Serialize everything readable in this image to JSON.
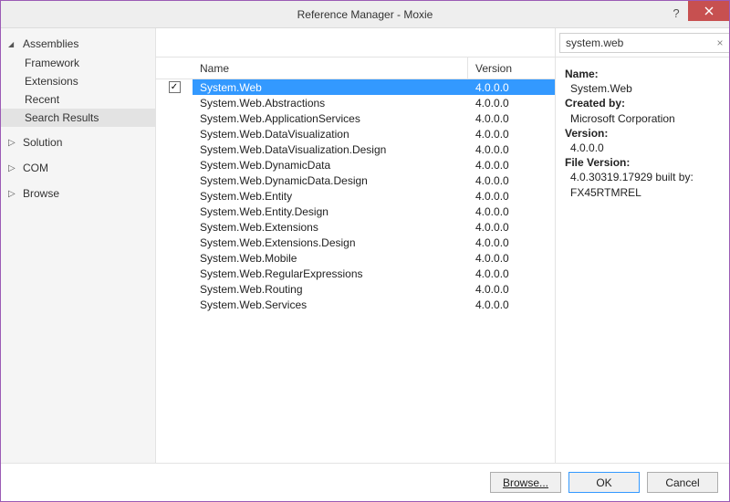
{
  "window": {
    "title": "Reference Manager - Moxie"
  },
  "sidebar": {
    "groups": [
      {
        "label": "Assemblies",
        "expanded": true,
        "items": [
          {
            "label": "Framework"
          },
          {
            "label": "Extensions"
          },
          {
            "label": "Recent"
          },
          {
            "label": "Search Results",
            "selected": true
          }
        ]
      },
      {
        "label": "Solution",
        "expanded": false
      },
      {
        "label": "COM",
        "expanded": false
      },
      {
        "label": "Browse",
        "expanded": false
      }
    ]
  },
  "search": {
    "value": "system.web"
  },
  "columns": {
    "name": "Name",
    "version": "Version"
  },
  "rows": [
    {
      "name": "System.Web",
      "version": "4.0.0.0",
      "checked": true,
      "selected": true
    },
    {
      "name": "System.Web.Abstractions",
      "version": "4.0.0.0"
    },
    {
      "name": "System.Web.ApplicationServices",
      "version": "4.0.0.0"
    },
    {
      "name": "System.Web.DataVisualization",
      "version": "4.0.0.0"
    },
    {
      "name": "System.Web.DataVisualization.Design",
      "version": "4.0.0.0"
    },
    {
      "name": "System.Web.DynamicData",
      "version": "4.0.0.0"
    },
    {
      "name": "System.Web.DynamicData.Design",
      "version": "4.0.0.0"
    },
    {
      "name": "System.Web.Entity",
      "version": "4.0.0.0"
    },
    {
      "name": "System.Web.Entity.Design",
      "version": "4.0.0.0"
    },
    {
      "name": "System.Web.Extensions",
      "version": "4.0.0.0"
    },
    {
      "name": "System.Web.Extensions.Design",
      "version": "4.0.0.0"
    },
    {
      "name": "System.Web.Mobile",
      "version": "4.0.0.0"
    },
    {
      "name": "System.Web.RegularExpressions",
      "version": "4.0.0.0"
    },
    {
      "name": "System.Web.Routing",
      "version": "4.0.0.0"
    },
    {
      "name": "System.Web.Services",
      "version": "4.0.0.0"
    }
  ],
  "details": {
    "name_label": "Name:",
    "name_value": "System.Web",
    "createdby_label": "Created by:",
    "createdby_value": "Microsoft Corporation",
    "version_label": "Version:",
    "version_value": "4.0.0.0",
    "filever_label": "File Version:",
    "filever_value1": "4.0.30319.17929 built by:",
    "filever_value2": "FX45RTMREL"
  },
  "footer": {
    "browse": "Browse...",
    "ok": "OK",
    "cancel": "Cancel"
  }
}
